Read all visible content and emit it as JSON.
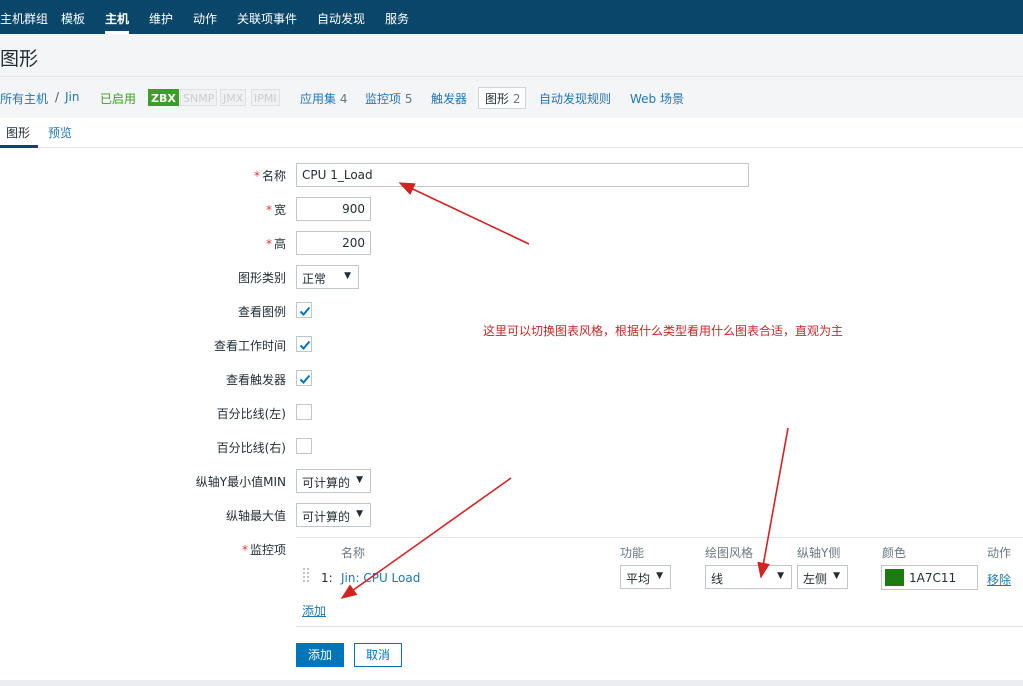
{
  "topnav": {
    "items": [
      "主机群组",
      "模板",
      "主机",
      "维护",
      "动作",
      "关联项事件",
      "自动发现",
      "服务"
    ],
    "active": "主机"
  },
  "page": {
    "title": "图形"
  },
  "hostbar": {
    "breadcrumb_all_hosts": "所有主机",
    "separator": "/",
    "host_name": "Jin",
    "status": "已启用",
    "badges": [
      "ZBX",
      "SNMP",
      "JMX",
      "IPMI"
    ],
    "tabs": [
      {
        "label": "应用集",
        "count": "4"
      },
      {
        "label": "监控项",
        "count": "5"
      },
      {
        "label": "触发器",
        "count": ""
      },
      {
        "label": "图形",
        "count": "2"
      },
      {
        "label": "自动发现规则",
        "count": ""
      },
      {
        "label": "Web 场景",
        "count": ""
      }
    ]
  },
  "subtabs": {
    "graph": "图形",
    "preview": "预览"
  },
  "form": {
    "name_label": "名称",
    "name_value": "CPU 1_Load",
    "width_label": "宽",
    "width_value": "900",
    "height_label": "高",
    "height_value": "200",
    "graph_type_label": "图形类别",
    "graph_type_value": "正常",
    "show_legend_label": "查看图例",
    "show_legend": true,
    "show_working_time_label": "查看工作时间",
    "show_working_time": true,
    "show_triggers_label": "查看触发器",
    "show_triggers": true,
    "percentile_left_label": "百分比线(左)",
    "percentile_left": false,
    "percentile_right_label": "百分比线(右)",
    "percentile_right": false,
    "ymin_label": "纵轴Y最小值MIN",
    "ymin_value": "可计算的",
    "ymax_label": "纵轴最大值",
    "ymax_value": "可计算的",
    "items_label": "监控项"
  },
  "items_table": {
    "headers": {
      "name": "名称",
      "function": "功能",
      "draw_style": "绘图风格",
      "y_axis_side": "纵轴Y侧",
      "color": "颜色",
      "action": "动作"
    },
    "rows": [
      {
        "index": "1:",
        "name": "Jin: CPU Load",
        "function": "平均",
        "draw_style": "线",
        "y_axis_side": "左侧",
        "color": "1A7C11",
        "action": "移除"
      }
    ],
    "add_link": "添加"
  },
  "buttons": {
    "add": "添加",
    "cancel": "取消"
  },
  "annotation": "这里可以切换图表风格，根据什么类型看用什么图表合适，直观为主",
  "colors": {
    "nav_bg": "#0a466a",
    "link": "#2277b5",
    "primary": "#0275b8",
    "enabled": "#3b9f27",
    "required": "#e33734",
    "annotation": "#c62828",
    "item_color": "#1A7C11"
  }
}
